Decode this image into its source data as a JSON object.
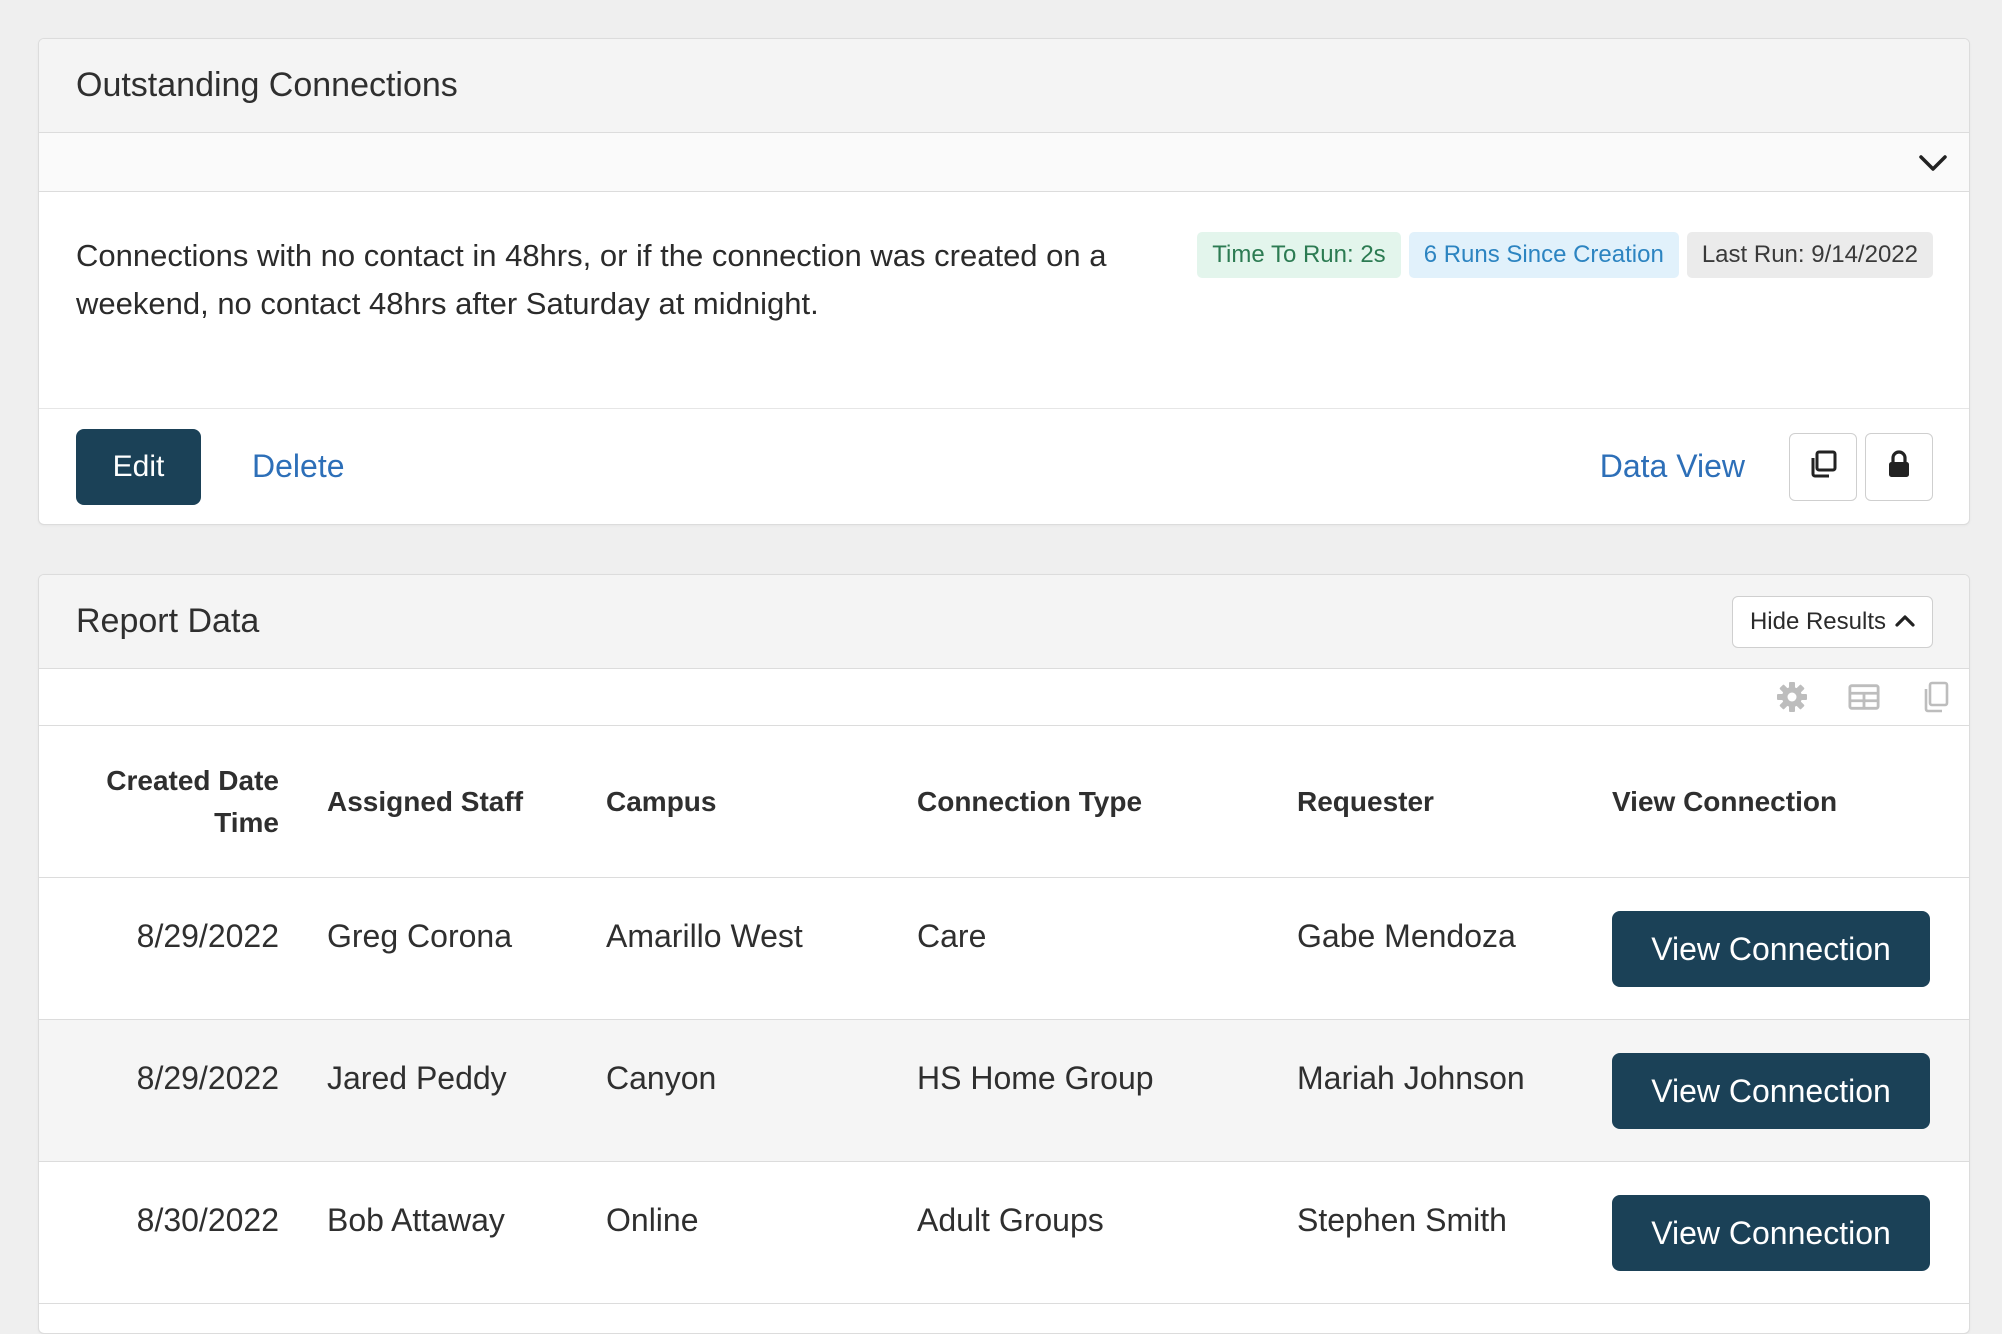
{
  "outstanding": {
    "title": "Outstanding Connections",
    "description": "Connections with no contact in 48hrs, or if the connection was created on a weekend, no contact 48hrs after Saturday at midnight.",
    "badges": {
      "time_to_run": "Time To Run: 2s",
      "runs": "6 Runs Since Creation",
      "last_run": "Last Run: 9/14/2022"
    },
    "actions": {
      "edit_label": "Edit",
      "delete_label": "Delete",
      "data_view_label": "Data View"
    }
  },
  "report": {
    "title": "Report Data",
    "hide_results_label": "Hide Results",
    "columns": {
      "created": "Created Date Time",
      "staff": "Assigned Staff",
      "campus": "Campus",
      "type": "Connection Type",
      "requester": "Requester",
      "view": "View Connection"
    },
    "rows": [
      {
        "created": "8/29/2022",
        "staff": "Greg Corona",
        "campus": "Amarillo West",
        "type": "Care",
        "requester": "Gabe Mendoza",
        "action": "View Connection"
      },
      {
        "created": "8/29/2022",
        "staff": "Jared Peddy",
        "campus": "Canyon",
        "type": "HS Home Group",
        "requester": "Mariah Johnson",
        "action": "View Connection"
      },
      {
        "created": "8/30/2022",
        "staff": "Bob Attaway",
        "campus": "Online",
        "type": "Adult Groups",
        "requester": "Stephen Smith",
        "action": "View Connection"
      }
    ]
  },
  "icons": {
    "filter_toggle": "chevron-down-icon",
    "copy": "copy-icon",
    "lock": "lock-icon",
    "hide": "chevron-up-icon",
    "settings": "gear-icon",
    "grid": "table-icon",
    "export": "clipboard-icon"
  },
  "colors": {
    "primary": "#1b4157",
    "link": "#2d6fb8",
    "badge_green_bg": "#e3f5ec",
    "badge_blue_bg": "#e1f1fb",
    "badge_gray_bg": "#ebebeb"
  }
}
